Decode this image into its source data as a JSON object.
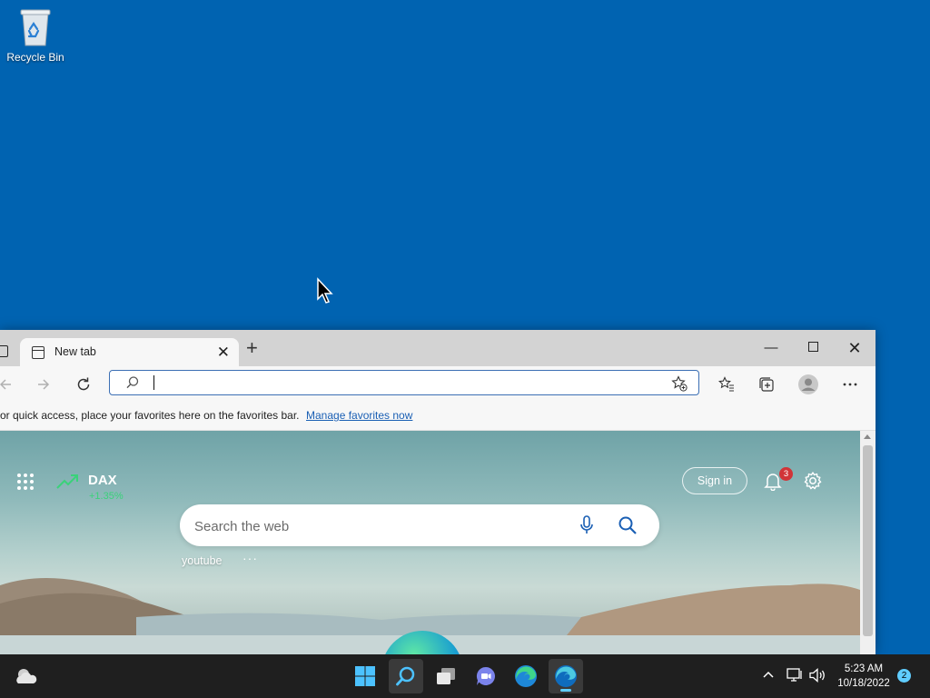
{
  "desktop": {
    "icons": [
      {
        "label": "Recycle Bin",
        "icon": "recycle-bin-icon"
      }
    ],
    "background_color": "#0063b1"
  },
  "browser": {
    "tab": {
      "title": "New tab",
      "icon": "page-icon"
    },
    "address_bar": {
      "value": "",
      "placeholder": ""
    },
    "favorites_bar": {
      "message": "or quick access, place your favorites here on the favorites bar.",
      "link": "Manage favorites now"
    },
    "newtab": {
      "ticker": {
        "name": "DAX",
        "change": "+1.35%"
      },
      "sign_in_label": "Sign in",
      "notification_count": "3",
      "search_placeholder": "Search the web",
      "quick_links": [
        "youtube"
      ],
      "quick_links_more": "···"
    }
  },
  "taskbar": {
    "apps": [
      "start",
      "search",
      "task-view",
      "teams-chat",
      "edge",
      "edge-dev"
    ],
    "clock": {
      "time": "5:23 AM",
      "date": "10/18/2022"
    },
    "notification_count": "2",
    "accent_color": "#60cdff"
  }
}
